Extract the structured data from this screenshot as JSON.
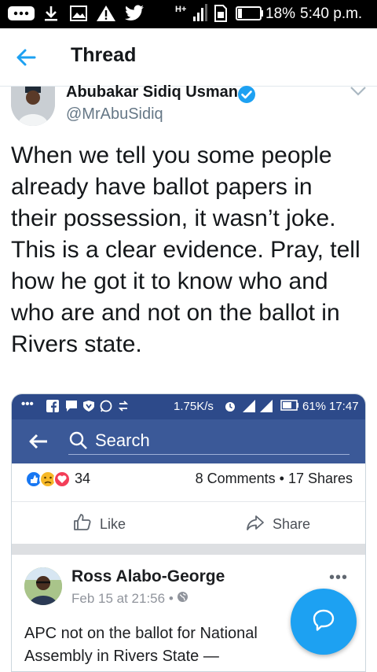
{
  "status_bar": {
    "battery": "18%",
    "time": "5:40 p.m.",
    "network": "H+"
  },
  "header": {
    "title": "Thread"
  },
  "tweet": {
    "author_name": "Abubakar Sidiq Usman",
    "author_handle": "@MrAbuSidiq",
    "text": "When we tell you some people already have ballot papers in their possession, it wasn’t joke. This is a clear evidence. Pray, tell how he got it to know who and who are and not on the ballot in Rivers state."
  },
  "embedded": {
    "status_bar": {
      "speed": "1.75K/s",
      "battery": "61%",
      "time": "17:47"
    },
    "search_label": "Search",
    "reaction_count": "34",
    "comments_shares": "8 Comments • 17 Shares",
    "like_label": "Like",
    "share_label": "Share",
    "post": {
      "author": "Ross Alabo-George",
      "time": "Feb 15 at 21:56 •",
      "text": "APC not on the ballot for National Assembly in Rivers State —"
    }
  },
  "colors": {
    "twitter_blue": "#1da1f2",
    "facebook_blue": "#3b5998",
    "status_black": "#000000"
  }
}
